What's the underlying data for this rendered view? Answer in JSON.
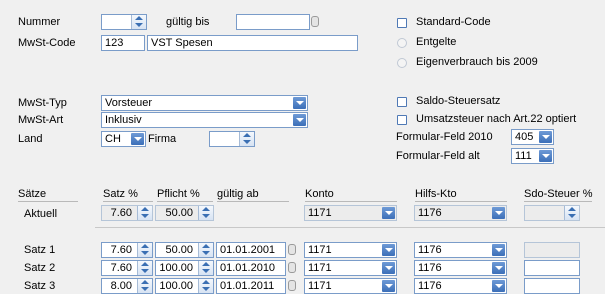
{
  "top": {
    "nummer_label": "Nummer",
    "nummer_value": "",
    "gueltig_bis_label": "gültig bis",
    "gueltig_bis_value": "",
    "mwst_code_label": "MwSt-Code",
    "mwst_code_value": "123",
    "mwst_code_desc": "VST Spesen"
  },
  "options": {
    "standard_code": "Standard-Code",
    "entgelte": "Entgelte",
    "eigenverbrauch": "Eigenverbrauch bis 2009",
    "saldo_steuersatz": "Saldo-Steuersatz",
    "umsatzsteuer": "Umsatzsteuer nach Art.22 optiert"
  },
  "mid": {
    "mwst_typ_label": "MwSt-Typ",
    "mwst_typ_value": "Vorsteuer",
    "mwst_art_label": "MwSt-Art",
    "mwst_art_value": "Inklusiv",
    "land_label": "Land",
    "land_value": "CH",
    "firma_label": "Firma",
    "firma_value": "",
    "formular_2010_label": "Formular-Feld 2010",
    "formular_2010_value": "405",
    "formular_alt_label": "Formular-Feld alt",
    "formular_alt_value": "111"
  },
  "table": {
    "headers": {
      "saetze": "Sätze",
      "satz": "Satz %",
      "pflicht": "Pflicht %",
      "gueltig_ab": "gültig ab",
      "konto": "Konto",
      "hilfs_kto": "Hilfs-Kto",
      "sdo_steuer": "Sdo-Steuer %"
    },
    "aktuell": {
      "label": "Aktuell",
      "satz": "7.60",
      "pflicht": "50.00",
      "konto": "1171",
      "hilfs": "1176"
    },
    "rows": [
      {
        "label": "Satz 1",
        "satz": "7.60",
        "pflicht": "50.00",
        "date": "01.01.2001",
        "konto": "1171",
        "hilfs": "1176"
      },
      {
        "label": "Satz 2",
        "satz": "7.60",
        "pflicht": "100.00",
        "date": "01.01.2010",
        "konto": "1171",
        "hilfs": "1176"
      },
      {
        "label": "Satz 3",
        "satz": "8.00",
        "pflicht": "100.00",
        "date": "01.01.2011",
        "konto": "1171",
        "hilfs": "1176"
      }
    ]
  }
}
